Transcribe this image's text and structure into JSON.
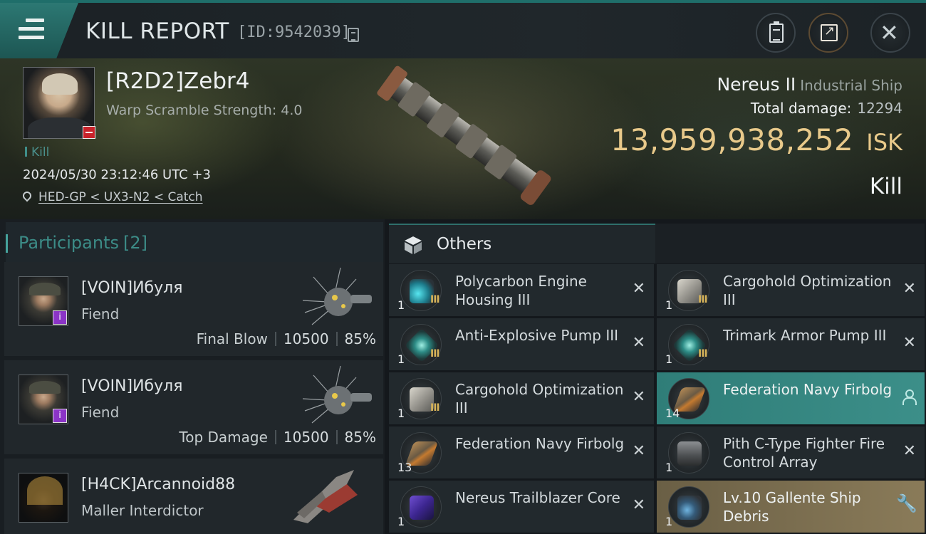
{
  "header": {
    "title": "KILL REPORT",
    "report_id": "[ID:9542039]"
  },
  "victim": {
    "name": "[R2D2]Zebr4",
    "warp_scramble": "Warp Scramble Strength: 4.0",
    "kill_tag": "Kill",
    "timestamp": "2024/05/30 23:12:46 UTC +3",
    "location": "HED-GP < UX3-N2 < Catch",
    "ship_name": "Nereus II",
    "ship_class": "Industrial Ship",
    "total_damage_label": "Total damage:",
    "total_damage": "12294",
    "isk_value": "13,959,938,252",
    "isk_unit": "ISK",
    "result": "Kill"
  },
  "participants": {
    "label": "Participants",
    "count": "[2]",
    "rows": [
      {
        "name": "[VOIN]Ибуля",
        "ship": "Fiend",
        "role": "Final Blow",
        "damage": "10500",
        "percent": "85%"
      },
      {
        "name": "[VOIN]Ибуля",
        "ship": "Fiend",
        "role": "Top Damage",
        "damage": "10500",
        "percent": "85%"
      },
      {
        "name": "[H4CK]Arcannoid88",
        "ship": "Maller Interdictor"
      }
    ]
  },
  "items": {
    "section_label": "Others",
    "list": [
      {
        "name": "Polycarbon Engine Housing III",
        "qty": "1",
        "tier": "III",
        "status": "destroyed",
        "icon": "engine-housing-icon"
      },
      {
        "name": "Cargohold Optimization III",
        "qty": "1",
        "tier": "III",
        "status": "destroyed",
        "icon": "cargohold-icon"
      },
      {
        "name": "Anti-Explosive Pump III",
        "qty": "1",
        "tier": "III",
        "status": "destroyed",
        "icon": "pump-icon"
      },
      {
        "name": "Trimark Armor Pump III",
        "qty": "1",
        "tier": "III",
        "status": "destroyed",
        "icon": "pump-icon"
      },
      {
        "name": "Cargohold Optimization III",
        "qty": "1",
        "tier": "III",
        "status": "destroyed",
        "icon": "cargohold-icon"
      },
      {
        "name": "Federation Navy Firbolg",
        "qty": "14",
        "status": "dropped",
        "icon": "fighter-icon"
      },
      {
        "name": "Federation Navy Firbolg",
        "qty": "13",
        "status": "destroyed",
        "icon": "fighter-icon"
      },
      {
        "name": "Pith C-Type Fighter Fire Control Array",
        "qty": "1",
        "status": "destroyed",
        "icon": "fire-control-icon"
      },
      {
        "name": "Nereus Trailblazer Core",
        "qty": "1",
        "status": "destroyed",
        "icon": "core-icon"
      },
      {
        "name": "Lv.10 Gallente Ship Debris",
        "qty": "1",
        "status": "salvage",
        "icon": "debris-icon"
      }
    ]
  },
  "colors": {
    "accent_teal": "#3c8f89",
    "isk_gold": "#e8c98a",
    "salvage_gold": "#8a7b59"
  }
}
